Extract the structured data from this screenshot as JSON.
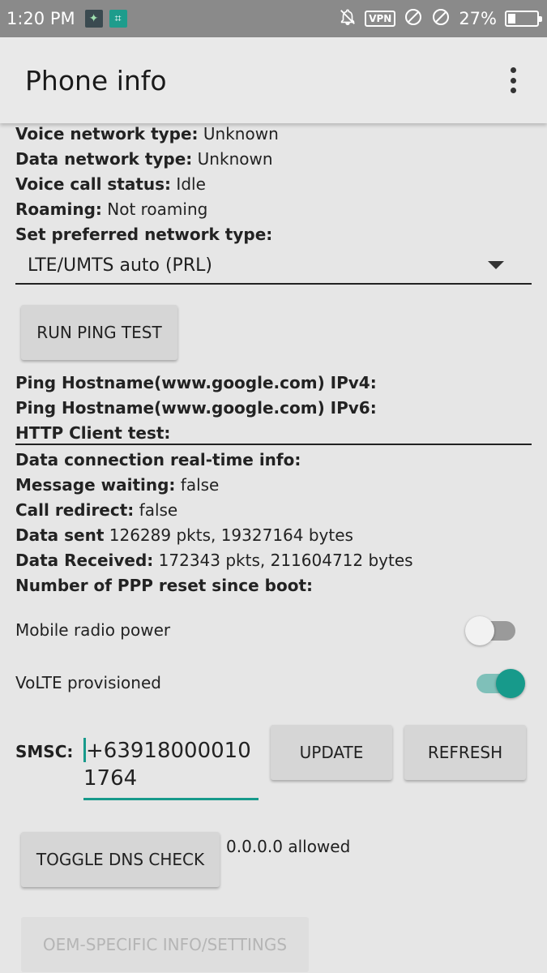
{
  "status_bar": {
    "time": "1:20 PM",
    "vpn": "VPN",
    "battery_percent": "27%",
    "battery_level": 27,
    "icons": [
      "app-icon",
      "screenshot-icon",
      "notifications-off-icon",
      "vpn-icon",
      "blocked-icon",
      "blocked-icon",
      "battery-icon"
    ]
  },
  "app_bar": {
    "title": "Phone info",
    "menu_icon": "more-vert-icon"
  },
  "info": {
    "voice_network_type": {
      "label": "Voice network type:",
      "value": "Unknown"
    },
    "data_network_type": {
      "label": "Data network type:",
      "value": "Unknown"
    },
    "voice_call_status": {
      "label": "Voice call status:",
      "value": "Idle"
    },
    "roaming": {
      "label": "Roaming:",
      "value": "Not roaming"
    },
    "preferred_network_label": "Set preferred network type:"
  },
  "preferred_network": {
    "selected": "LTE/UMTS auto (PRL)"
  },
  "ping": {
    "button_label": "RUN PING TEST",
    "ipv4_label": "Ping Hostname(www.google.com) IPv4:",
    "ipv6_label": "Ping Hostname(www.google.com) IPv6:",
    "http_label": "HTTP Client test:"
  },
  "connection": {
    "realtime_label": "Data connection real-time info:",
    "message_waiting": {
      "label": "Message waiting:",
      "value": "false"
    },
    "call_redirect": {
      "label": "Call redirect:",
      "value": "false"
    },
    "data_sent": {
      "label": "Data sent",
      "value": "126289 pkts, 19327164 bytes"
    },
    "data_received": {
      "label": "Data Received:",
      "value": "172343 pkts, 211604712 bytes"
    },
    "ppp_reset_label": "Number of PPP reset since boot:"
  },
  "toggles": {
    "mobile_radio": {
      "label": "Mobile radio power",
      "on": false
    },
    "volte": {
      "label": "VoLTE provisioned",
      "on": true
    }
  },
  "smsc": {
    "label": "SMSC:",
    "value": "+639180000101764",
    "update_label": "UPDATE",
    "refresh_label": "REFRESH"
  },
  "dns": {
    "button_label": "TOGGLE DNS CHECK",
    "status": "0.0.0.0 allowed"
  },
  "oem": {
    "button_label": "OEM-SPECIFIC INFO/SETTINGS"
  },
  "colors": {
    "accent": "#179a8b",
    "switch_off_track": "#9a9a9a",
    "switch_off_thumb": "#f2f2f2"
  }
}
